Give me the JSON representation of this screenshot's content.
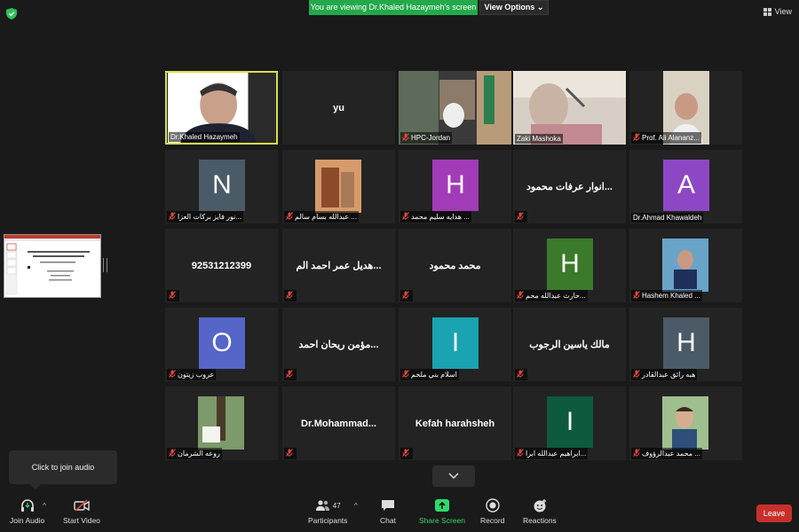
{
  "header": {
    "banner": "You are viewing Dr.Khaled Hazaymeh's screen",
    "view_options": "View Options",
    "view": "View"
  },
  "colors": {
    "background": "#1a1a1a",
    "tile": "#232323",
    "active_speaker_border": "#d6e14a",
    "banner_green": "#23a94b",
    "leave_red": "#c9302c",
    "share_green": "#2fd96a"
  },
  "tiles": [
    {
      "label": "Dr.Khaled Hazaymeh",
      "center": "",
      "avatar": "",
      "kind": "video",
      "muted": false
    },
    {
      "label": "",
      "center": "yu",
      "avatar": "",
      "kind": "name",
      "muted": false
    },
    {
      "label": "HPC-Jordan",
      "center": "",
      "avatar": "",
      "kind": "video",
      "muted": true
    },
    {
      "label": "Zaki Mashoka",
      "center": "",
      "avatar": "",
      "kind": "video",
      "muted": false
    },
    {
      "label": "Prof. Ali Alananz...",
      "center": "",
      "avatar": "",
      "kind": "video",
      "muted": true
    },
    {
      "label": "نور فايز بركات العزا...",
      "center": "",
      "avatar": "N",
      "avatar_color": "#4a5a66",
      "kind": "avatar",
      "muted": true
    },
    {
      "label": "عبدالله بسام سالم ...",
      "center": "",
      "avatar": "",
      "kind": "photo",
      "muted": true
    },
    {
      "label": "هدايه سليم محمد ...",
      "center": "",
      "avatar": "H",
      "avatar_color": "#a23bb8",
      "kind": "avatar",
      "muted": true
    },
    {
      "label": "",
      "center": "انوار عرفات محمود...",
      "avatar": "",
      "kind": "name",
      "muted": true
    },
    {
      "label": "Dr.Ahmad Khawaldeh",
      "center": "",
      "avatar": "A",
      "avatar_color": "#8e47c4",
      "kind": "avatar",
      "muted": false
    },
    {
      "label": "",
      "center": "92531212399",
      "avatar": "",
      "kind": "name",
      "muted": true
    },
    {
      "label": "",
      "center": "هديل عمر احمد الم...",
      "avatar": "",
      "kind": "name",
      "muted": true
    },
    {
      "label": "",
      "center": "محمد محمود",
      "avatar": "",
      "kind": "name",
      "muted": true
    },
    {
      "label": "حارث عبدالله محم...",
      "center": "",
      "avatar": "H",
      "avatar_color": "#3a7a2a",
      "kind": "avatar",
      "muted": true
    },
    {
      "label": "Hashem Khaled ...",
      "center": "",
      "avatar": "",
      "kind": "photo",
      "muted": true
    },
    {
      "label": "عروب زيتون",
      "center": "",
      "avatar": "O",
      "avatar_color": "#5566c8",
      "kind": "avatar",
      "muted": true
    },
    {
      "label": "",
      "center": "مؤمن ريحان احمد...",
      "avatar": "",
      "kind": "name",
      "muted": true
    },
    {
      "label": "اسلام بني ملحم",
      "center": "",
      "avatar": "I",
      "avatar_color": "#1aa3b0",
      "kind": "avatar",
      "muted": true
    },
    {
      "label": "",
      "center": "مالك ياسين الرجوب",
      "avatar": "",
      "kind": "name",
      "muted": true
    },
    {
      "label": "هبه رائق عبدالقادر",
      "center": "",
      "avatar": "H",
      "avatar_color": "#4a5a66",
      "kind": "avatar",
      "muted": true
    },
    {
      "label": "روعه الشرمان",
      "center": "",
      "avatar": "",
      "kind": "photo",
      "muted": true
    },
    {
      "label": "",
      "center": "Dr.Mohammad...",
      "avatar": "",
      "kind": "name",
      "muted": true
    },
    {
      "label": "",
      "center": "Kefah harahsheh",
      "avatar": "",
      "kind": "name",
      "muted": true
    },
    {
      "label": "ابراهيم عبدالله ابرا...",
      "center": "",
      "avatar": "I",
      "avatar_color": "#0e5a3e",
      "kind": "avatar",
      "muted": true
    },
    {
      "label": "محمد عبدالرؤوف ...",
      "center": "",
      "avatar": "",
      "kind": "photo",
      "muted": true
    }
  ],
  "tooltip": "Click to join audio",
  "toolbar": {
    "join_audio": "Join Audio",
    "start_video": "Start Video",
    "participants": "Participants",
    "participant_count": "47",
    "chat": "Chat",
    "share_screen": "Share Screen",
    "record": "Record",
    "reactions": "Reactions",
    "leave": "Leave"
  }
}
